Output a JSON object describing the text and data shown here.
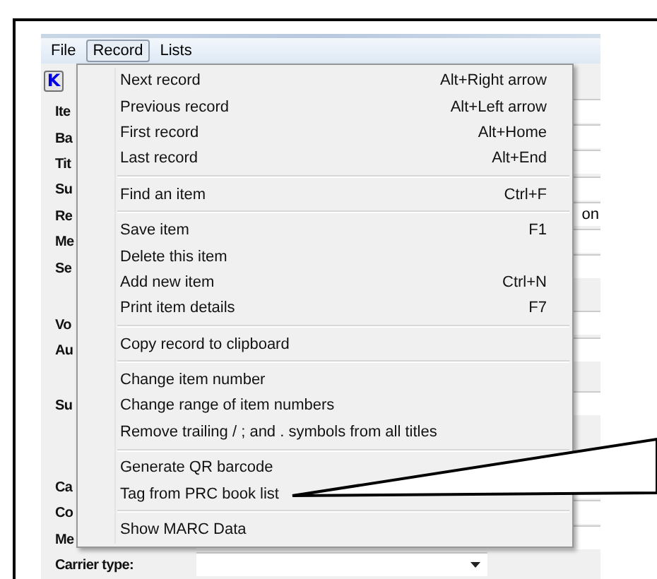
{
  "menu_bar": [
    {
      "label": "File",
      "selected": false
    },
    {
      "label": "Record",
      "selected": true
    },
    {
      "label": "Lists",
      "selected": false
    }
  ],
  "toolbar": {
    "first_record_button": "K"
  },
  "form": {
    "groups": [
      [
        {
          "label": "Ite",
          "kind": "field"
        },
        {
          "label": "Ba",
          "kind": "field"
        },
        {
          "label": "Tit",
          "kind": "field"
        },
        {
          "label": "Su",
          "kind": "field"
        },
        {
          "label": "Re",
          "kind": "field",
          "value": "on"
        },
        {
          "label": "Me",
          "kind": "field"
        },
        {
          "label": "Se",
          "kind": "field"
        }
      ],
      [
        {
          "label": "Vo",
          "kind": "field"
        },
        {
          "label": "Au",
          "kind": "field"
        }
      ],
      [
        {
          "label": "Su",
          "kind": "field"
        }
      ],
      [
        {
          "label": "Ca",
          "kind": "field"
        },
        {
          "label": "Co",
          "kind": "field"
        },
        {
          "label": "Me",
          "kind": "field"
        },
        {
          "label": "Carrier type:",
          "kind": "dropdown"
        }
      ]
    ]
  },
  "menu": {
    "sections": [
      [
        {
          "label": "Next record",
          "shortcut": "Alt+Right arrow"
        },
        {
          "label": "Previous record",
          "shortcut": "Alt+Left arrow"
        },
        {
          "label": "First record",
          "shortcut": "Alt+Home"
        },
        {
          "label": "Last record",
          "shortcut": "Alt+End"
        }
      ],
      [
        {
          "label": "Find an item",
          "shortcut": "Ctrl+F"
        }
      ],
      [
        {
          "label": "Save item",
          "shortcut": "F1"
        },
        {
          "label": "Delete this item"
        },
        {
          "label": "Add new item",
          "shortcut": "Ctrl+N"
        },
        {
          "label": "Print item details",
          "shortcut": "F7"
        }
      ],
      [
        {
          "label": "Copy record to clipboard"
        }
      ],
      [
        {
          "label": "Change item number"
        },
        {
          "label": "Change range of item numbers"
        },
        {
          "label": "Remove trailing / ; and . symbols from all titles"
        }
      ],
      [
        {
          "label": "Generate QR barcode"
        },
        {
          "label": "Tag from PRC book list"
        }
      ],
      [
        {
          "label": "Show MARC Data"
        }
      ]
    ]
  }
}
